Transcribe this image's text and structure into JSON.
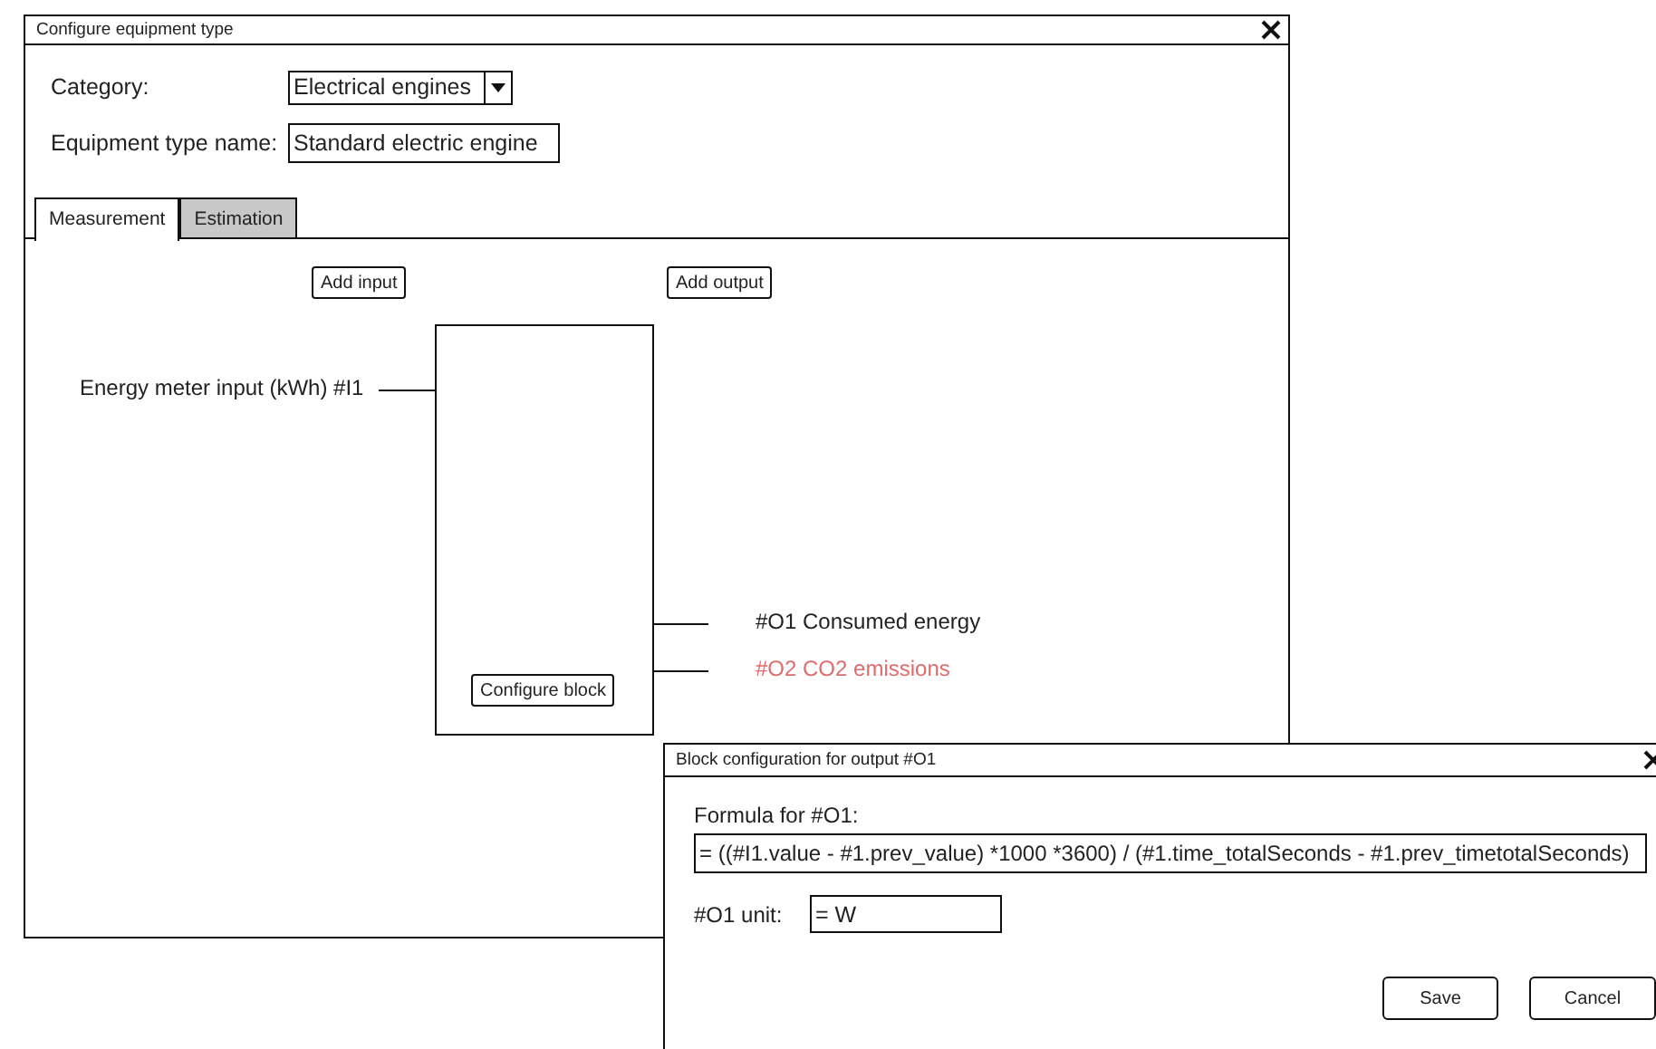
{
  "main_window": {
    "title": "Configure equipment type",
    "category": {
      "label": "Category:",
      "value": "Electrical engines"
    },
    "name_field": {
      "label": "Equipment type name:",
      "value": "Standard electric engine"
    },
    "tabs": [
      {
        "label": "Measurement",
        "selected": true
      },
      {
        "label": "Estimation",
        "selected": false
      }
    ],
    "diagram": {
      "add_input": "Add input",
      "add_output": "Add output",
      "configure_block": "Configure block",
      "inputs": [
        {
          "label": "Energy meter input (kWh) #I1"
        }
      ],
      "outputs": [
        {
          "label": "#O1 Consumed energy",
          "color": "#222222"
        },
        {
          "label": "#O2 CO2 emissions",
          "color": "#e06b6b"
        }
      ]
    }
  },
  "dialog": {
    "title": "Block configuration for output #O1",
    "formula_label": "Formula for #O1:",
    "formula_value": "= ((#I1.value - #1.prev_value) *1000 *3600) / (#1.time_totalSeconds - #1.prev_timetotalSeconds)",
    "unit_label": "#O1 unit:",
    "unit_value": "= W",
    "buttons": [
      "Save",
      "Cancel"
    ]
  }
}
